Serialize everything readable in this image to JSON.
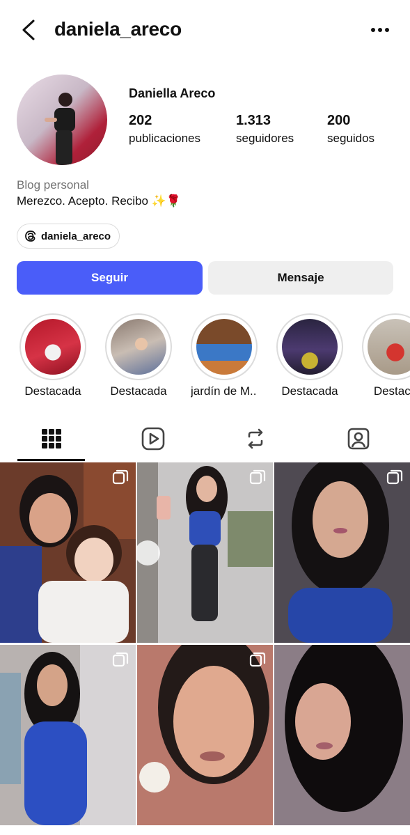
{
  "header": {
    "username": "daniela_areco"
  },
  "profile": {
    "full_name": "Daniella Areco",
    "stats": [
      {
        "value": "202",
        "label": "publicaciones"
      },
      {
        "value": "1.313",
        "label": "seguidores"
      },
      {
        "value": "200",
        "label": "seguidos"
      }
    ],
    "category": "Blog personal",
    "bio": "Merezco. Acepto. Recibo ✨🌹",
    "threads_handle": "daniela_areco"
  },
  "actions": {
    "follow_label": "Seguir",
    "message_label": "Mensaje"
  },
  "highlights": [
    {
      "label": "Destacada"
    },
    {
      "label": "Destacada"
    },
    {
      "label": "jardín de M..."
    },
    {
      "label": "Destacada"
    },
    {
      "label": "Destaca"
    }
  ],
  "tabs": [
    {
      "icon": "grid-icon",
      "active": true
    },
    {
      "icon": "reels-icon",
      "active": false
    },
    {
      "icon": "reposts-icon",
      "active": false
    },
    {
      "icon": "tagged-icon",
      "active": false
    }
  ],
  "posts": [
    {
      "multi": true
    },
    {
      "multi": true
    },
    {
      "multi": true
    },
    {
      "multi": true
    },
    {
      "multi": true
    },
    {
      "multi": false
    }
  ],
  "colors": {
    "accent": "#4a5df9",
    "secondary_button": "#efefef",
    "muted_text": "#737373"
  }
}
